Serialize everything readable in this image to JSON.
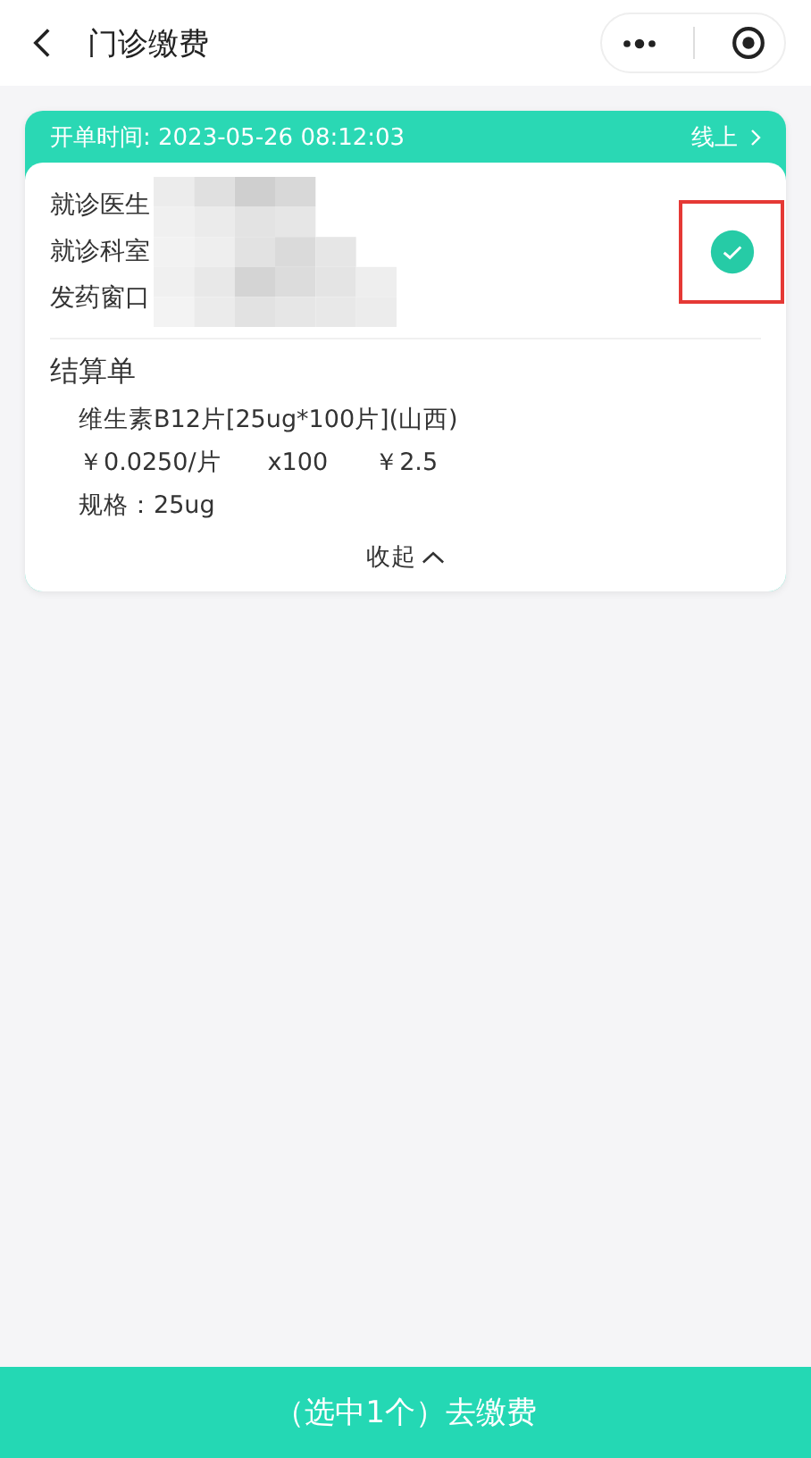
{
  "nav": {
    "title": "门诊缴费"
  },
  "order": {
    "time_label": "开单时间: 2023-05-26 08:12:03",
    "channel": "线上",
    "info": [
      {
        "label": "就诊医生"
      },
      {
        "label": "就诊科室"
      },
      {
        "label": "发药窗口"
      }
    ],
    "selected": true,
    "section_title": "结算单",
    "items": [
      {
        "name": "维生素B12片[25ug*100片](山西)",
        "price": "￥0.0250/片",
        "qty": "x100",
        "amount": "￥2.5",
        "spec": "规格：25ug"
      }
    ],
    "collapse": "收起"
  },
  "pay_button": "（选中1个）去缴费"
}
